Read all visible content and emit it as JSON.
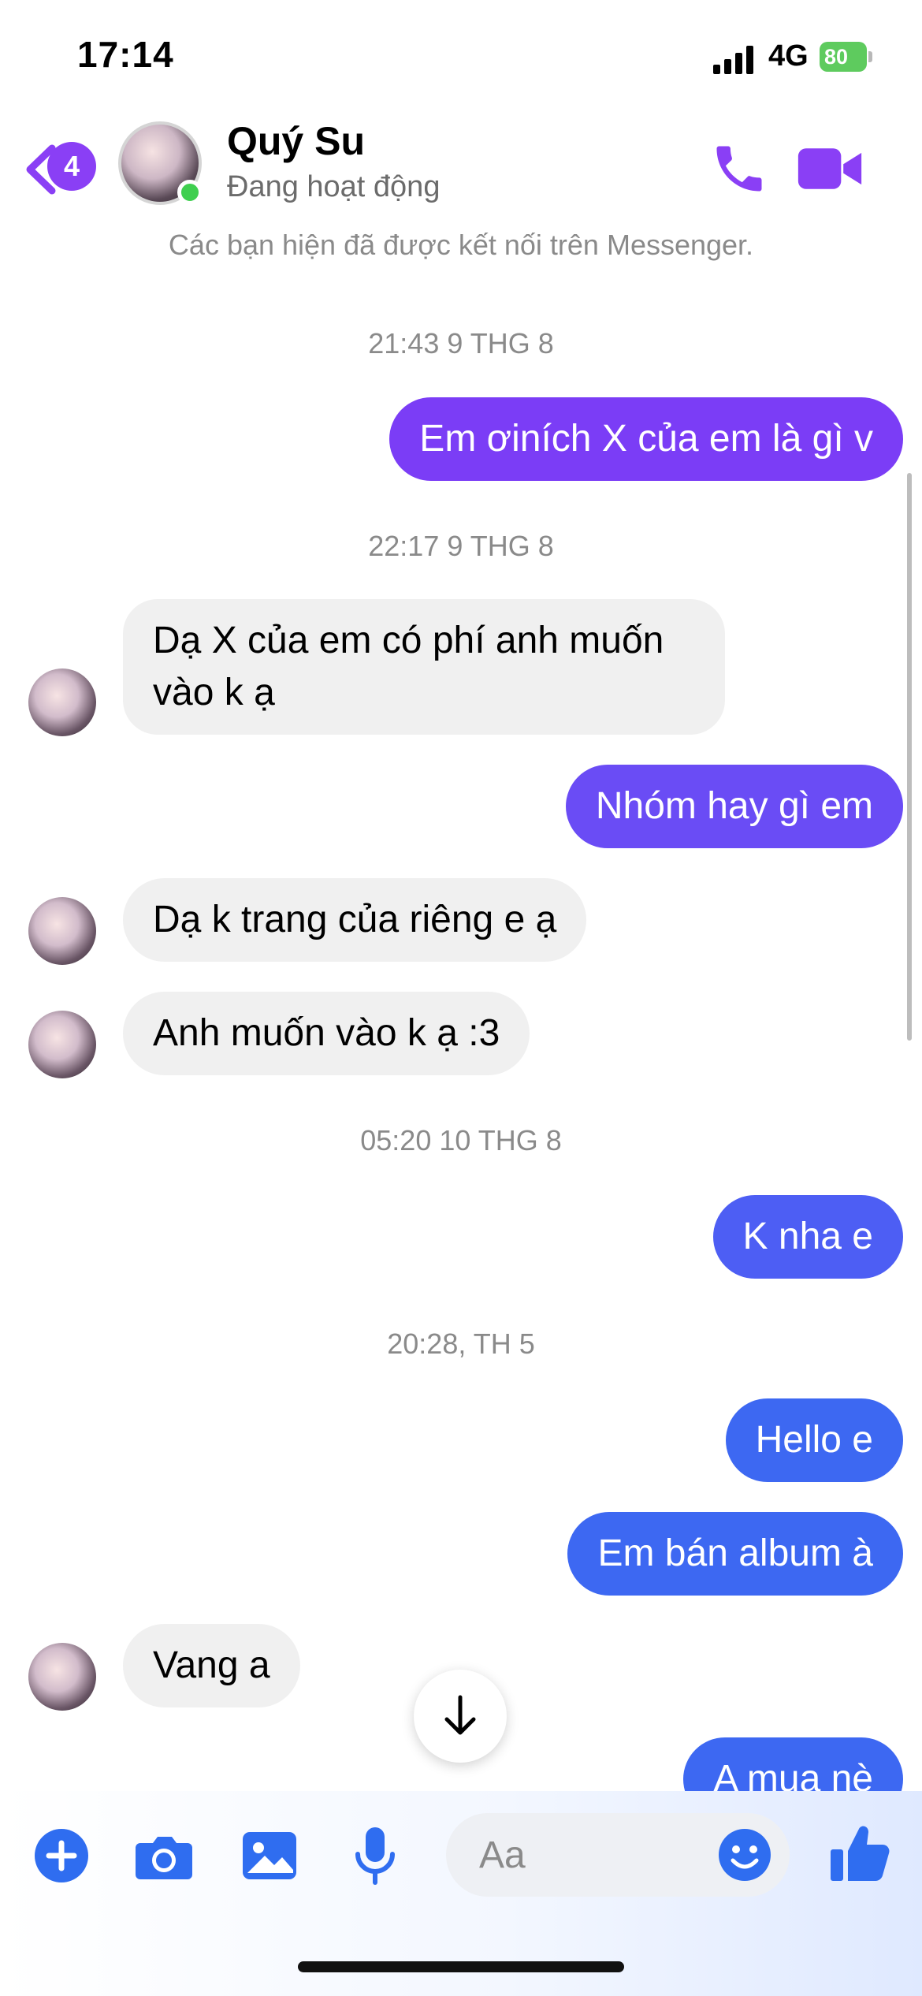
{
  "status_bar": {
    "time": "17:14",
    "network": "4G",
    "battery": "80"
  },
  "header": {
    "unread_count": "4",
    "contact_name": "Quý Su",
    "presence": "Đang hoạt động"
  },
  "connected_notice": "Các bạn hiện đã được kết nối trên Messenger.",
  "timestamps": [
    "21:43 9 THG 8",
    "22:17 9 THG 8",
    "05:20 10 THG 8",
    "20:28, TH 5"
  ],
  "messages": [
    {
      "from": "me",
      "text": "Em ơiních X của em là gì v"
    },
    {
      "from": "them",
      "text": "Dạ X của em có phí anh muốn vào k ạ"
    },
    {
      "from": "me",
      "text": "Nhóm hay gì em"
    },
    {
      "from": "them",
      "text": "Dạ k trang của riêng e ạ"
    },
    {
      "from": "them",
      "text": "Anh muốn vào k ạ :3"
    },
    {
      "from": "me",
      "text": "K nha e"
    },
    {
      "from": "me",
      "text": "Hello e"
    },
    {
      "from": "me",
      "text": "Em bán album à"
    },
    {
      "from": "them",
      "text": "Vang a"
    },
    {
      "from": "me",
      "text": "A mua nè"
    }
  ],
  "composer": {
    "placeholder": "Aa"
  },
  "colors": {
    "accent_purple": "#8a3ff5",
    "bubble_purple": "#7b3df6",
    "bubble_violet": "#6a4cf5",
    "bubble_blue": "#3d68f2",
    "icon_blue": "#2f6df0",
    "incoming_bg": "#f0f0f0"
  }
}
